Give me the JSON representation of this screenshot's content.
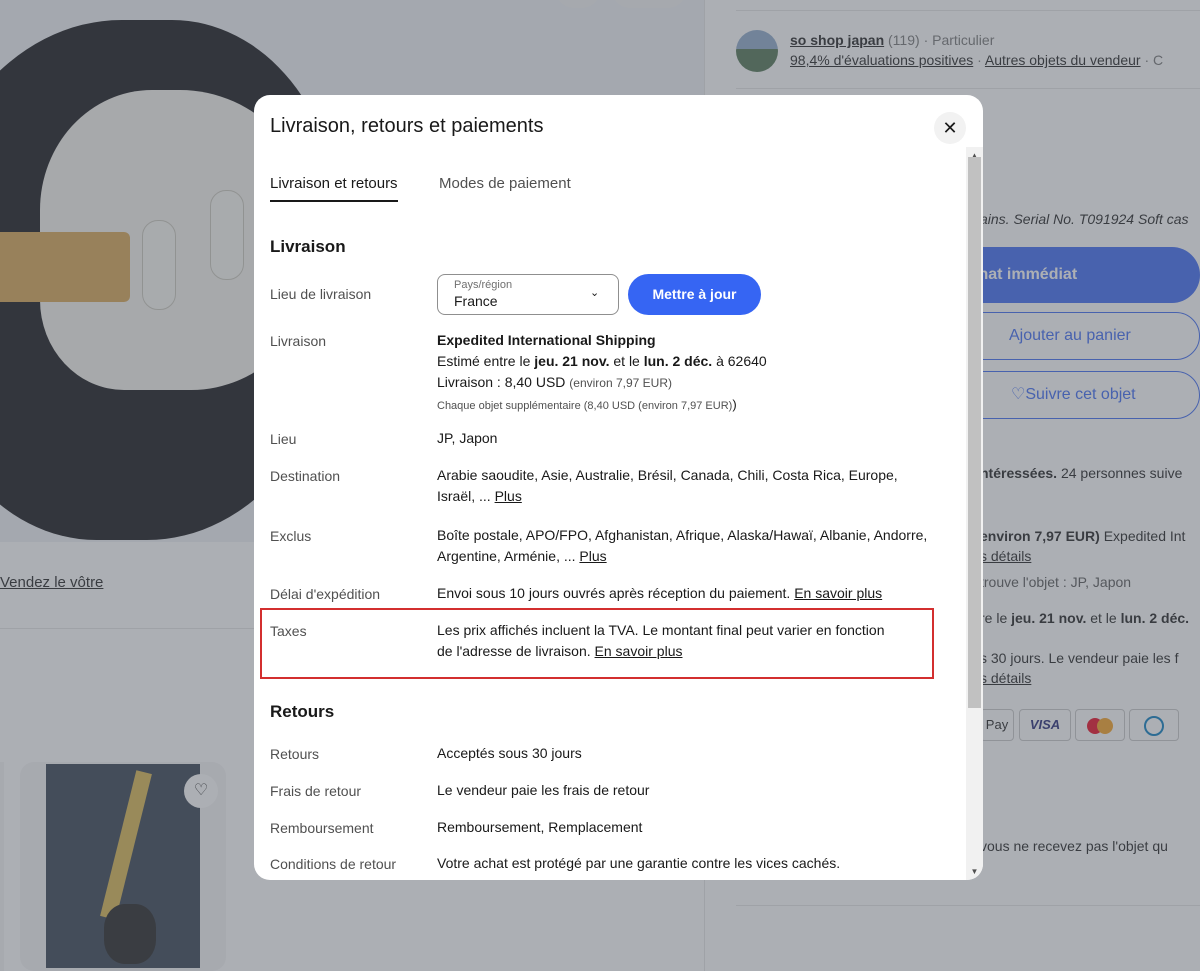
{
  "background": {
    "vendez_label": "Vendez le vôtre",
    "seller": {
      "name": "so shop japan",
      "count": "(119)",
      "type": "· Particulier",
      "positive": "98,4% d'évaluations positives",
      "sep": "·",
      "other_items": "Autres objets du vendeur",
      "more": "· C"
    },
    "description_snippet": "ains. Serial No. T091924 Soft cas",
    "buy_now": "Achat immédiat",
    "add_to_cart": "Ajouter au panier",
    "watch": "♡Suivre cet objet",
    "interest_bold": "ntéressées.",
    "interest_rest": " 24 personnes suive",
    "shipping_price": "environ 7,97 EUR)",
    "shipping_method": " Expedited Int",
    "details_link_1": "s détails",
    "item_location": "trouve l'objet : JP, Japon",
    "delivery_date_a": "re le ",
    "delivery_date_b": "jeu. 21 nov.",
    "delivery_date_c": " et le ",
    "delivery_date_d": "lun. 2 déc.",
    "returns_summary": "s 30 jours. Le vendeur paie les f",
    "details_link_2": "s détails",
    "pay_labels": [
      "Pay",
      "VISA",
      "",
      ""
    ],
    "guarantee_text": "vous ne recevez pas l'objet qu",
    "colors": {
      "primary": "#3665f3",
      "highlight_border": "#d32f2f"
    }
  },
  "dialog": {
    "title": "Livraison, retours et paiements",
    "close_icon": "close-icon",
    "tabs": [
      {
        "label": "Livraison et retours",
        "active": true
      },
      {
        "label": "Modes de paiement",
        "active": false
      }
    ],
    "shipping_section": {
      "title": "Livraison",
      "location_label": "Lieu de livraison",
      "select_label": "Pays/région",
      "select_value": "France",
      "update_button": "Mettre à jour",
      "delivery_label": "Livraison",
      "service_name": "Expedited International Shipping",
      "estimate_prefix": "Estimé entre le ",
      "estimate_from": "jeu. 21 nov.",
      "estimate_mid": " et le ",
      "estimate_to": "lun. 2 déc.",
      "estimate_suffix": " à 62640",
      "cost_prefix": "Livraison : 8,40 USD ",
      "cost_approx": "(environ 7,97 EUR)",
      "additional_text": "Chaque objet supplémentaire (8,40 USD (environ 7,97 EUR)",
      "additional_close": ")",
      "origin_label": "Lieu",
      "origin_value": "JP, Japon",
      "destination_label": "Destination",
      "destination_value": "Arabie saoudite, Asie, Australie, Brésil, Canada, Chili, Costa Rica, Europe, Israël, ... ",
      "destination_more": "Plus",
      "excluded_label": "Exclus",
      "excluded_value": "Boîte postale, APO/FPO, Afghanistan, Afrique, Alaska/Hawaï, Albanie, Andorre, Argentine, Arménie, ... ",
      "excluded_more": "Plus",
      "handling_label": "Délai d'expédition",
      "handling_value": "Envoi sous 10 jours ouvrés après réception du paiement. ",
      "handling_link": "En savoir plus",
      "taxes_label": "Taxes",
      "taxes_value": "Les prix affichés incluent la TVA. Le montant final peut varier en fonction de l'adresse de livraison. ",
      "taxes_link": "En savoir plus"
    },
    "returns_section": {
      "title": "Retours",
      "returns_label": "Retours",
      "returns_value": "Acceptés sous 30 jours",
      "fees_label": "Frais de retour",
      "fees_value": "Le vendeur paie les frais de retour",
      "refund_label": "Remboursement",
      "refund_value": "Remboursement, Remplacement",
      "conditions_label": "Conditions de retour",
      "conditions_value": "Votre achat est protégé par une garantie contre les vices cachés."
    }
  }
}
